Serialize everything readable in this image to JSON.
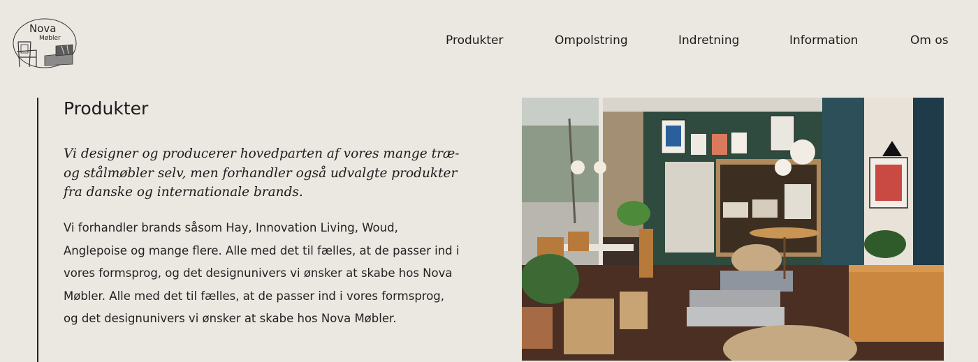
{
  "brand": {
    "name_line1": "Nova",
    "name_line2": "Møbler"
  },
  "nav": {
    "items": [
      {
        "label": "Produkter"
      },
      {
        "label": "Ompolstring"
      },
      {
        "label": "Indretning"
      },
      {
        "label": "Information"
      },
      {
        "label": "Om os"
      }
    ]
  },
  "main": {
    "title": "Produkter",
    "lead": "Vi designer og producerer hovedparten af vores mange træ- og stålmøbler selv, men forhandler også udvalgte produkter fra danske og internationale brands.",
    "body": "Vi forhandler brands såsom Hay, Innovation Living, Woud, Anglepoise og mange flere. Alle med det til fælles, at de passer ind i vores formsprog, og det designunivers vi ønsker at skabe hos Nova Møbler. Alle med det til fælles, at de passer ind i vores formsprog, og det designunivers vi ønsker at skabe hos Nova Møbler."
  },
  "colors": {
    "background": "#ebe7e1",
    "text": "#1c1c1c",
    "accent_wall": "#2f4a3f",
    "floor": "#4a2f22"
  }
}
